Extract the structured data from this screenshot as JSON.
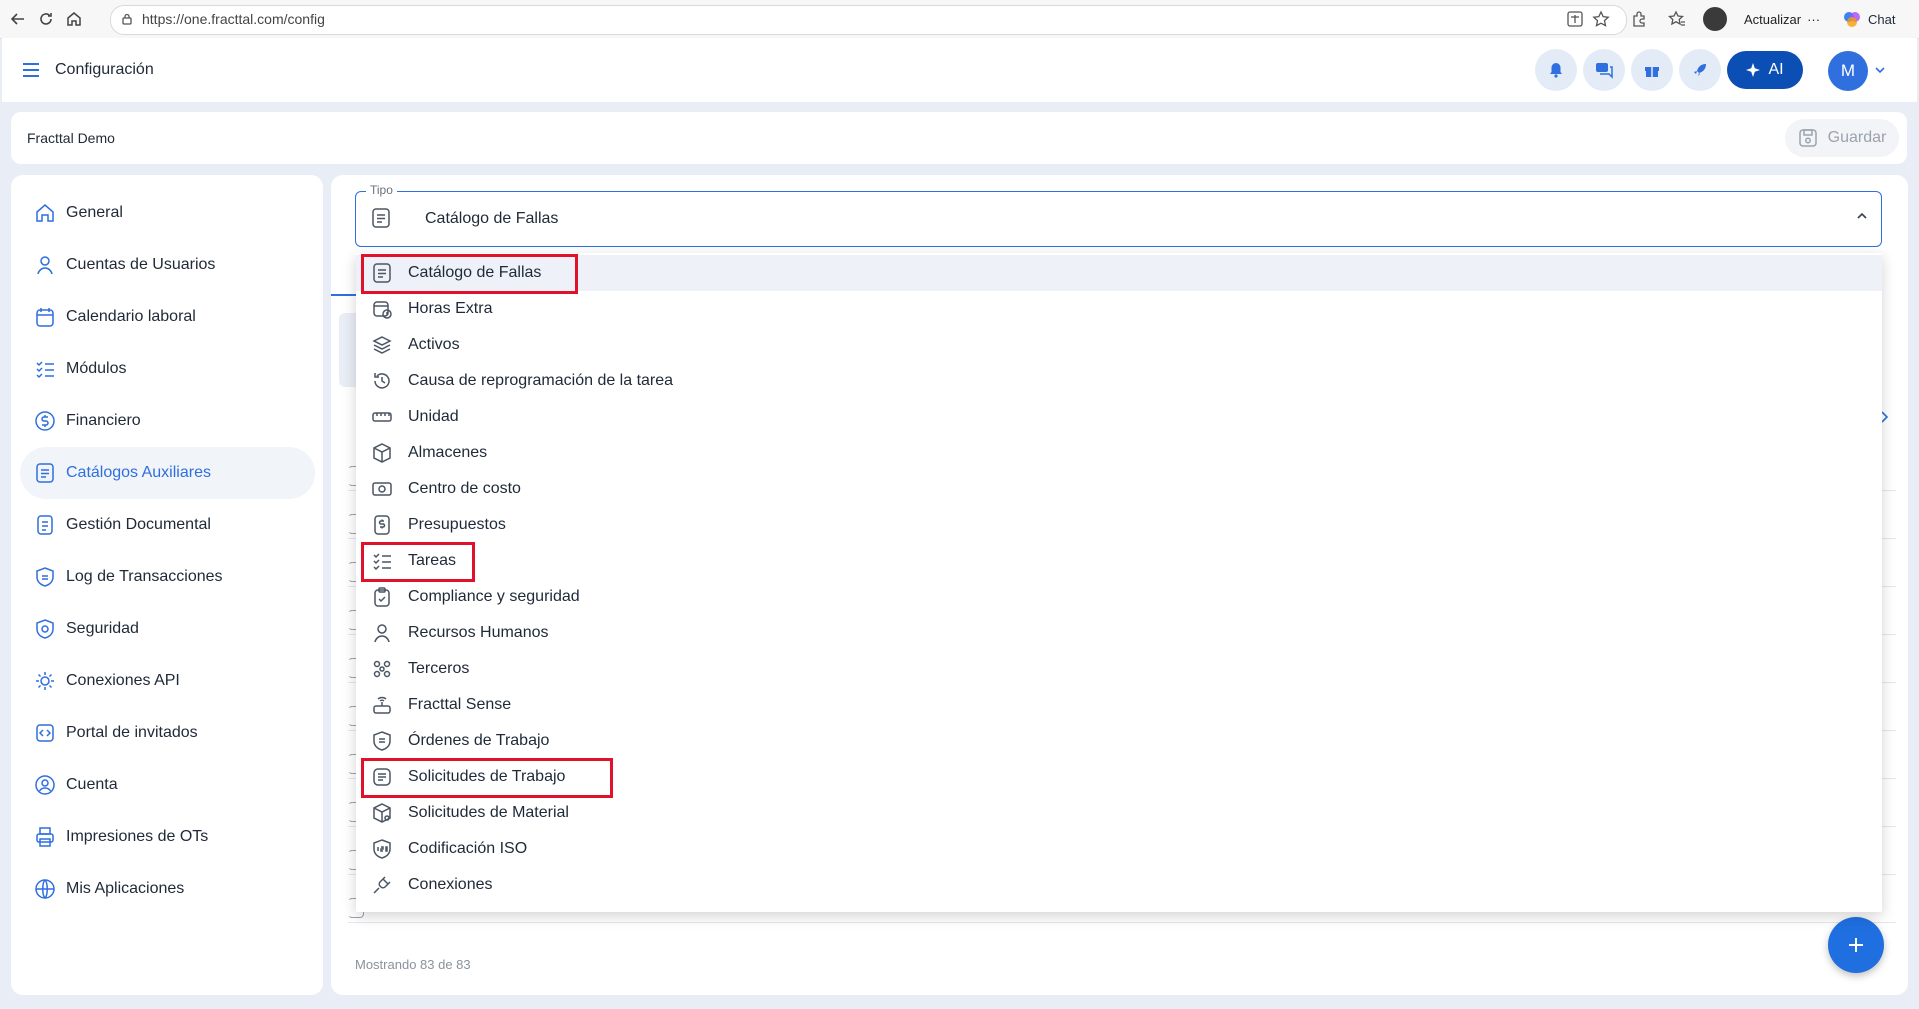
{
  "browser": {
    "url": "https://one.fracttal.com/config",
    "update_label": "Actualizar",
    "more_label": "···",
    "chat_label": "Chat"
  },
  "header": {
    "title": "Configuración",
    "ai_label": "AI",
    "avatar_initial": "M"
  },
  "company": {
    "name": "Fracttal Demo",
    "save_label": "Guardar"
  },
  "sidebar": {
    "items": [
      {
        "label": "General",
        "icon": "home-icon"
      },
      {
        "label": "Cuentas de Usuarios",
        "icon": "user-icon"
      },
      {
        "label": "Calendario laboral",
        "icon": "calendar-icon"
      },
      {
        "label": "Módulos",
        "icon": "list-check-icon"
      },
      {
        "label": "Financiero",
        "icon": "dollar-circle-icon"
      },
      {
        "label": "Catálogos Auxiliares",
        "icon": "catalog-icon",
        "active": true
      },
      {
        "label": "Gestión Documental",
        "icon": "document-icon"
      },
      {
        "label": "Log de Transacciones",
        "icon": "shield-log-icon"
      },
      {
        "label": "Seguridad",
        "icon": "security-icon"
      },
      {
        "label": "Conexiones API",
        "icon": "api-gear-icon"
      },
      {
        "label": "Portal de invitados",
        "icon": "portal-icon"
      },
      {
        "label": "Cuenta",
        "icon": "account-icon"
      },
      {
        "label": "Impresiones de OTs",
        "icon": "printer-icon"
      },
      {
        "label": "Mis Aplicaciones",
        "icon": "globe-icon"
      }
    ]
  },
  "tipo": {
    "label": "Tipo",
    "value": "Catálogo de Fallas"
  },
  "dropdown": {
    "options": [
      {
        "label": "Catálogo de Fallas",
        "icon": "catalog-icon",
        "selected": true,
        "highlighted": true
      },
      {
        "label": "Horas Extra",
        "icon": "calendar-clock-icon"
      },
      {
        "label": "Activos",
        "icon": "layers-icon"
      },
      {
        "label": "Causa de reprogramación de la tarea",
        "icon": "history-icon"
      },
      {
        "label": "Unidad",
        "icon": "ruler-icon"
      },
      {
        "label": "Almacenes",
        "icon": "box-icon"
      },
      {
        "label": "Centro de costo",
        "icon": "cost-center-icon"
      },
      {
        "label": "Presupuestos",
        "icon": "budget-icon"
      },
      {
        "label": "Tareas",
        "icon": "list-check-icon",
        "highlighted": true
      },
      {
        "label": "Compliance y seguridad",
        "icon": "clipboard-check-icon"
      },
      {
        "label": "Recursos Humanos",
        "icon": "person-icon"
      },
      {
        "label": "Terceros",
        "icon": "people-icon"
      },
      {
        "label": "Fracttal Sense",
        "icon": "sensor-icon"
      },
      {
        "label": "Órdenes de Trabajo",
        "icon": "work-order-icon"
      },
      {
        "label": "Solicitudes de Trabajo",
        "icon": "work-request-icon",
        "highlighted": true
      },
      {
        "label": "Solicitudes de Material",
        "icon": "material-box-icon"
      },
      {
        "label": "Codificación ISO",
        "icon": "iso-icon"
      },
      {
        "label": "Conexiones",
        "icon": "plug-icon"
      }
    ]
  },
  "footer": {
    "showing": "Mostrando 83 de 83"
  },
  "colors": {
    "accent": "#2f6fde",
    "ai_button": "#0b4fb5",
    "highlight": "#e0112b"
  }
}
